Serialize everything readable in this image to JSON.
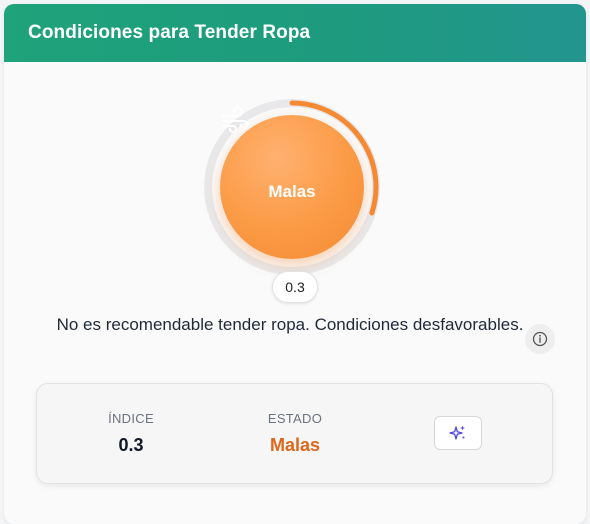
{
  "header": {
    "title": "Condiciones para Tender Ropa"
  },
  "gauge": {
    "status": "Malas",
    "value": "0.3",
    "fraction": 0.3,
    "icon": "wind-icon",
    "accent": "#f58a33"
  },
  "message": "No es recomendable tender ropa. Condiciones desfavorables.",
  "stats": {
    "indice": {
      "label": "ÍNDICE",
      "value": "0.3"
    },
    "estado": {
      "label": "ESTADO",
      "value": "Malas"
    }
  },
  "icons": {
    "info": "info-icon",
    "sparkle": "sparkle-icon"
  },
  "colors": {
    "header_start": "#1fa37a",
    "header_end": "#23958f",
    "estado": "#e0661a",
    "sparkle": "#4f46e5"
  }
}
